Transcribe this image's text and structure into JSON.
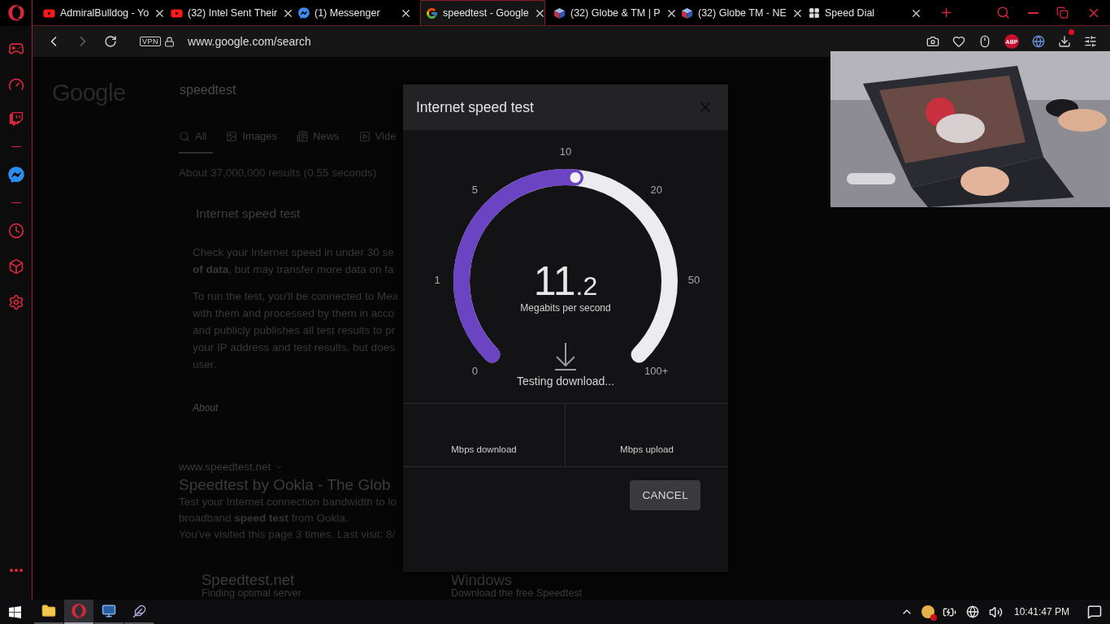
{
  "browser": {
    "tabs": [
      {
        "title": "AdmiralBulldog - Yo",
        "kind": "youtube",
        "selected": false
      },
      {
        "title": "(32) Intel Sent Their",
        "kind": "youtube",
        "selected": false
      },
      {
        "title": "(1) Messenger",
        "kind": "messenger",
        "selected": false
      },
      {
        "title": "speedtest - Google",
        "kind": "google",
        "selected": true
      },
      {
        "title": "(32) Globe & TM | P",
        "kind": "cube",
        "selected": false
      },
      {
        "title": "(32) Globe TM - NE",
        "kind": "cube",
        "selected": false
      },
      {
        "title": "Speed Dial",
        "kind": "grid",
        "selected": false
      }
    ],
    "address_bar": {
      "badge": "VPN",
      "url": "www.google.com/search",
      "adblock": "ABP"
    }
  },
  "page": {
    "logo": "Google",
    "query": "speedtest",
    "tabs": [
      {
        "label": "All",
        "selected": true
      },
      {
        "label": "Images",
        "selected": false
      },
      {
        "label": "News",
        "selected": false
      },
      {
        "label": "Vide",
        "selected": false
      }
    ],
    "result_stats": "About 37,000,000 results (0.55 seconds)",
    "card": {
      "title": "Internet speed test",
      "paragraphs": [
        [
          "Check your Internet speed in under 30 se",
          "**of data**, but may transfer more data on fa"
        ],
        [
          "To run the test, you'll be connected to Mea",
          "with them and processed by them in acco",
          "and publicly publishes all test results to pr",
          "your IP address and test results, but does",
          "user."
        ]
      ],
      "footer": "About"
    },
    "result": {
      "url": "www.speedtest.net",
      "title": "Speedtest by Ookla - The Glob",
      "snippet": [
        "Test your Internet connection bandwidth to lo",
        "broadband **speed test** from Ookla."
      ],
      "visited": "You've visited this page 3 times. Last visit: 8/",
      "sitelinks": [
        {
          "title": "Speedtest.net",
          "text": "Finding optimal server"
        },
        {
          "title": "Windows",
          "text": "Download the free Speedtest"
        }
      ]
    }
  },
  "dialog": {
    "title": "Internet speed test",
    "gauge": {
      "ticks": [
        "0",
        "1",
        "5",
        "10",
        "20",
        "50",
        "100+"
      ],
      "level": 0.52,
      "value": "11",
      "decimal": ".2",
      "unit": "Megabits per second",
      "status": "Testing download..."
    },
    "results": [
      {
        "label": "Mbps download"
      },
      {
        "label": "Mbps upload"
      }
    ],
    "button": "CANCEL"
  },
  "taskbar": {
    "apps": [
      {
        "kind": "explorer",
        "selected": false
      },
      {
        "kind": "opera",
        "selected": true
      },
      {
        "kind": "monitor",
        "selected": false
      },
      {
        "kind": "feather",
        "selected": false
      }
    ],
    "clock": "10:41:47 PM"
  }
}
